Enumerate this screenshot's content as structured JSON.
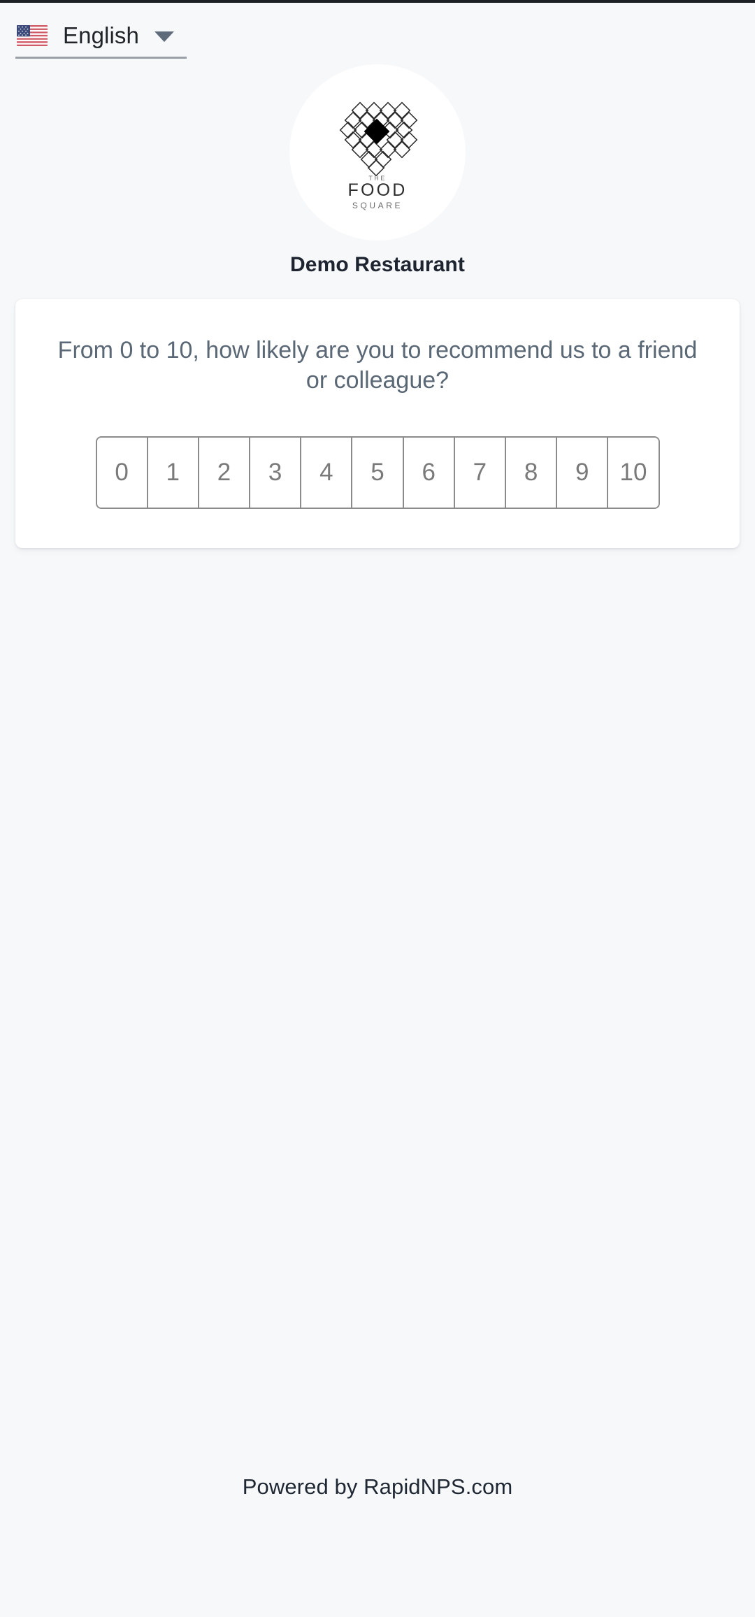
{
  "language_selector": {
    "flag_icon": "us-flag-icon",
    "label": "English",
    "caret_icon": "chevron-down-icon"
  },
  "brand": {
    "logo_icon": "the-food-square-logo",
    "logo_text_top": "THE",
    "logo_text_main": "FOOD",
    "logo_text_bottom": "SQUARE",
    "name": "Demo Restaurant"
  },
  "survey": {
    "question": "From 0 to 10, how likely are you to recommend us to a friend or colleague?",
    "scale": [
      "0",
      "1",
      "2",
      "3",
      "4",
      "5",
      "6",
      "7",
      "8",
      "9",
      "10"
    ]
  },
  "footer": {
    "text": "Powered by RapidNPS.com"
  },
  "colors": {
    "page_background": "#f6f8fa",
    "card_background": "#ffffff",
    "question_text": "#5a6775",
    "scale_border": "#8b8b8b",
    "scale_text": "#7a7a7a",
    "brand_name_text": "#1e2430",
    "footer_text": "#1f2733",
    "caret": "#5f6b7a",
    "underline": "#9aa0a6"
  }
}
